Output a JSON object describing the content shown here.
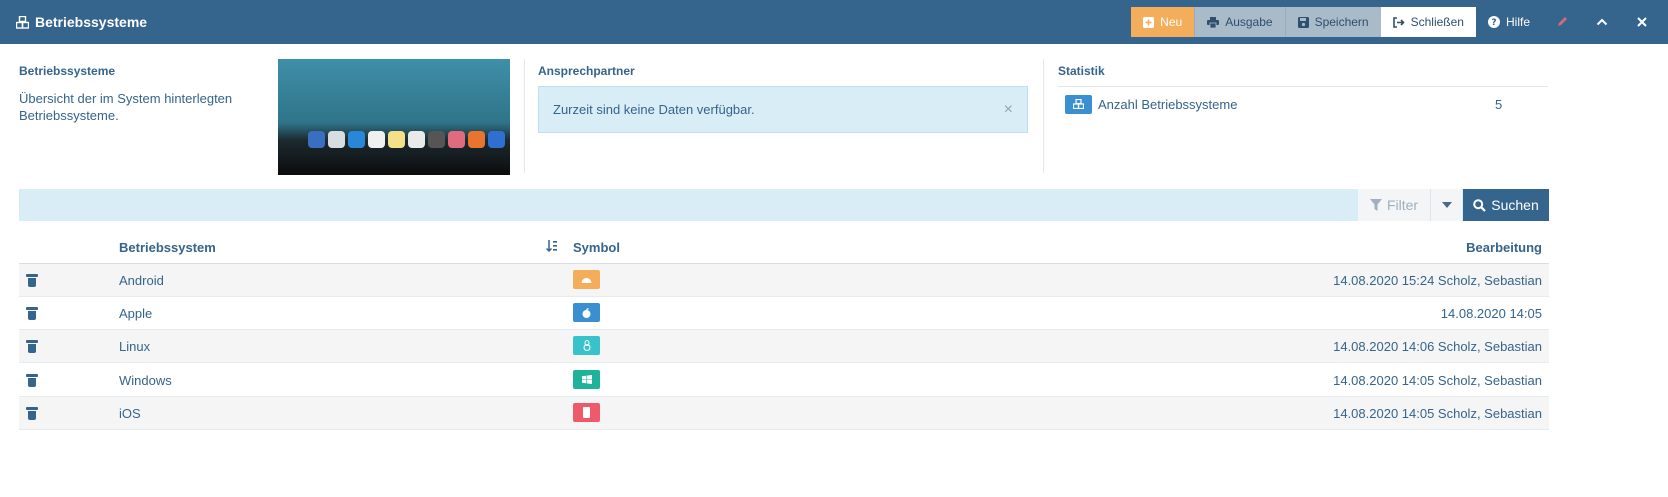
{
  "header": {
    "title": "Betriebssysteme",
    "buttons": {
      "neu": "Neu",
      "ausgabe": "Ausgabe",
      "speichern": "Speichern",
      "schliessen": "Schließen",
      "hilfe": "Hilfe"
    },
    "colors": {
      "bar": "#35648c",
      "neu": "#f4ad5b",
      "grey": "#a9bac9"
    }
  },
  "info": {
    "label": "Betriebssysteme",
    "description": "Übersicht der im System hinterlegten Betriebssysteme."
  },
  "contact": {
    "label": "Ansprechpartner",
    "alert": "Zurzeit sind keine Daten verfügbar."
  },
  "stats": {
    "label": "Statistik",
    "items": [
      {
        "label": "Anzahl Betriebssysteme",
        "value": "5"
      }
    ]
  },
  "toolbar": {
    "filter": "Filter",
    "search": "Suchen"
  },
  "table": {
    "columns": {
      "name": "Betriebssystem",
      "symbol": "Symbol",
      "edit": "Bearbeitung"
    },
    "rows": [
      {
        "name": "Android",
        "edit": "14.08.2020 15:24 Scholz, Sebastian",
        "color": "#f4ad5b",
        "icon": "android-icon"
      },
      {
        "name": "Apple",
        "edit": "14.08.2020 14:05",
        "color": "#3a8fd0",
        "icon": "apple-icon"
      },
      {
        "name": "Linux",
        "edit": "14.08.2020 14:06 Scholz, Sebastian",
        "color": "#37c3c9",
        "icon": "linux-icon"
      },
      {
        "name": "Windows",
        "edit": "14.08.2020 14:05 Scholz, Sebastian",
        "color": "#1eb39a",
        "icon": "windows-icon"
      },
      {
        "name": "iOS",
        "edit": "14.08.2020 14:05 Scholz, Sebastian",
        "color": "#ee5a6a",
        "icon": "mobile-icon"
      }
    ]
  }
}
